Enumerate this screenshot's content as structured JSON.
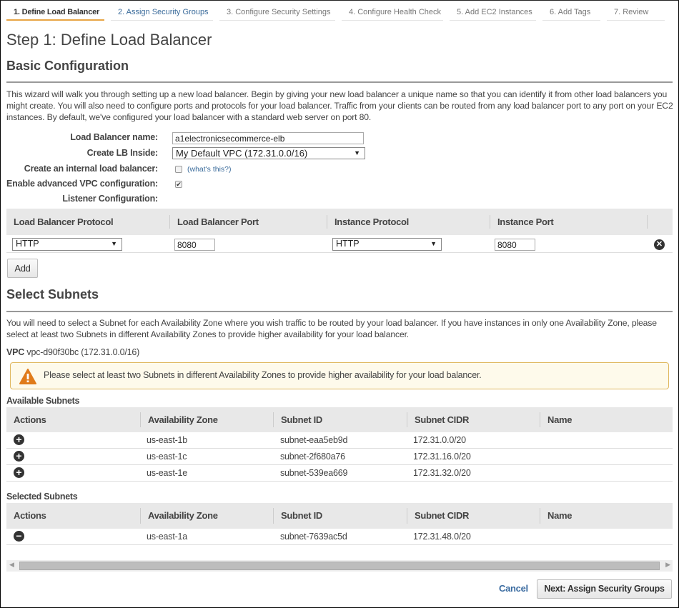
{
  "wizard_tabs": [
    {
      "label": "1. Define Load Balancer",
      "state": "active"
    },
    {
      "label": "2. Assign Security Groups",
      "state": "next"
    },
    {
      "label": "3. Configure Security Settings",
      "state": "disabled"
    },
    {
      "label": "4. Configure Health Check",
      "state": "disabled"
    },
    {
      "label": "5. Add EC2 Instances",
      "state": "disabled"
    },
    {
      "label": "6. Add Tags",
      "state": "disabled"
    },
    {
      "label": "7. Review",
      "state": "disabled"
    }
  ],
  "page_title": "Step 1: Define Load Balancer",
  "basic_config": {
    "title": "Basic Configuration",
    "description": "This wizard will walk you through setting up a new load balancer. Begin by giving your new load balancer a unique name so that you can identify it from other load balancers you might create. You will also need to configure ports and protocols for your load balancer. Traffic from your clients can be routed from any load balancer port to any port on your EC2 instances. By default, we've configured your load balancer with a standard web server on port 80.",
    "fields": {
      "name_label": "Load Balancer name:",
      "name_value": "a1electronicsecommerce-elb",
      "inside_label": "Create LB Inside:",
      "inside_value": "My Default VPC (172.31.0.0/16)",
      "internal_label": "Create an internal load balancer:",
      "internal_checked": false,
      "internal_help": "(what's this?)",
      "advanced_label": "Enable advanced VPC configuration:",
      "advanced_checked": true,
      "listener_label": "Listener Configuration:"
    }
  },
  "listeners": {
    "columns": [
      "Load Balancer Protocol",
      "Load Balancer Port",
      "Instance Protocol",
      "Instance Port"
    ],
    "rows": [
      {
        "lb_protocol": "HTTP",
        "lb_port": "8080",
        "instance_protocol": "HTTP",
        "instance_port": "8080"
      }
    ],
    "add_label": "Add"
  },
  "subnets": {
    "title": "Select Subnets",
    "description": "You will need to select a Subnet for each Availability Zone where you wish traffic to be routed by your load balancer. If you have instances in only one Availability Zone, please select at least two Subnets in different Availability Zones to provide higher availability for your load balancer.",
    "vpc_label": "VPC",
    "vpc_value": "vpc-d90f30bc (172.31.0.0/16)",
    "warning": "Please select at least two Subnets in different Availability Zones to provide higher availability for your load balancer.",
    "columns": [
      "Actions",
      "Availability Zone",
      "Subnet ID",
      "Subnet CIDR",
      "Name"
    ],
    "available_title": "Available Subnets",
    "available": [
      {
        "zone": "us-east-1b",
        "id": "subnet-eaa5eb9d",
        "cidr": "172.31.0.0/20",
        "name": ""
      },
      {
        "zone": "us-east-1c",
        "id": "subnet-2f680a76",
        "cidr": "172.31.16.0/20",
        "name": ""
      },
      {
        "zone": "us-east-1e",
        "id": "subnet-539ea669",
        "cidr": "172.31.32.0/20",
        "name": ""
      }
    ],
    "selected_title": "Selected Subnets",
    "selected": [
      {
        "zone": "us-east-1a",
        "id": "subnet-7639ac5d",
        "cidr": "172.31.48.0/20",
        "name": ""
      }
    ]
  },
  "footer": {
    "cancel_label": "Cancel",
    "next_label": "Next: Assign Security Groups"
  },
  "icons": {
    "add_subnet": "plus-circle-icon",
    "remove_subnet": "minus-circle-icon",
    "remove_listener": "x-circle-icon",
    "warning": "warning-triangle-icon",
    "dropdown": "caret-down-icon"
  },
  "colors": {
    "active_tab_underline": "#e7a545",
    "link": "#3a6ba0",
    "warning_bg": "#fefaeb",
    "warning_border": "#e0b860",
    "warning_icon": "#e07b1a"
  }
}
